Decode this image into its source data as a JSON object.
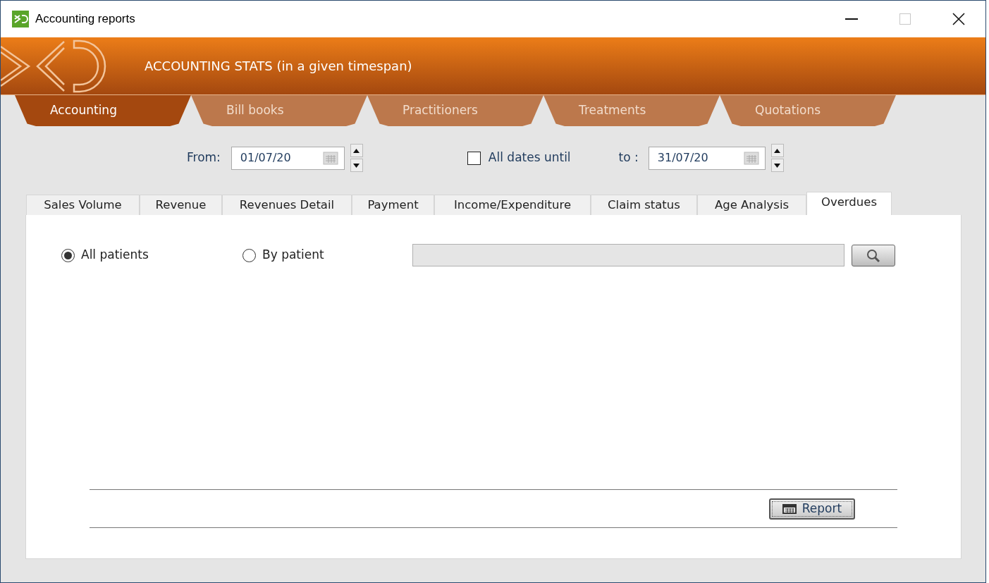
{
  "window": {
    "title": "Accounting reports",
    "maximize_disabled": true
  },
  "header": {
    "title": "ACCOUNTING STATS (in a given timespan)"
  },
  "main_tabs": [
    {
      "label": "Accounting",
      "selected": true
    },
    {
      "label": "Bill books",
      "selected": false
    },
    {
      "label": "Practitioners",
      "selected": false
    },
    {
      "label": "Treatments",
      "selected": false
    },
    {
      "label": "Quotations",
      "selected": false
    }
  ],
  "date_range": {
    "from_label": "From:",
    "from_value": "01/07/20",
    "all_dates_label": "All dates until",
    "all_dates_checked": false,
    "to_label": "to :",
    "to_value": "31/07/20"
  },
  "report_tabs": [
    {
      "label": "Sales Volume",
      "selected": false
    },
    {
      "label": "Revenue",
      "selected": false
    },
    {
      "label": "Revenues Detail",
      "selected": false
    },
    {
      "label": "Payment",
      "selected": false
    },
    {
      "label": "Income/Expenditure",
      "selected": false
    },
    {
      "label": "Claim status",
      "selected": false
    },
    {
      "label": "Age Analysis",
      "selected": false
    },
    {
      "label": "Overdues",
      "selected": true
    }
  ],
  "patient_filter": [
    {
      "label": "All patients",
      "selected": true
    },
    {
      "label": "By patient",
      "selected": false
    }
  ],
  "report_button": "Report"
}
